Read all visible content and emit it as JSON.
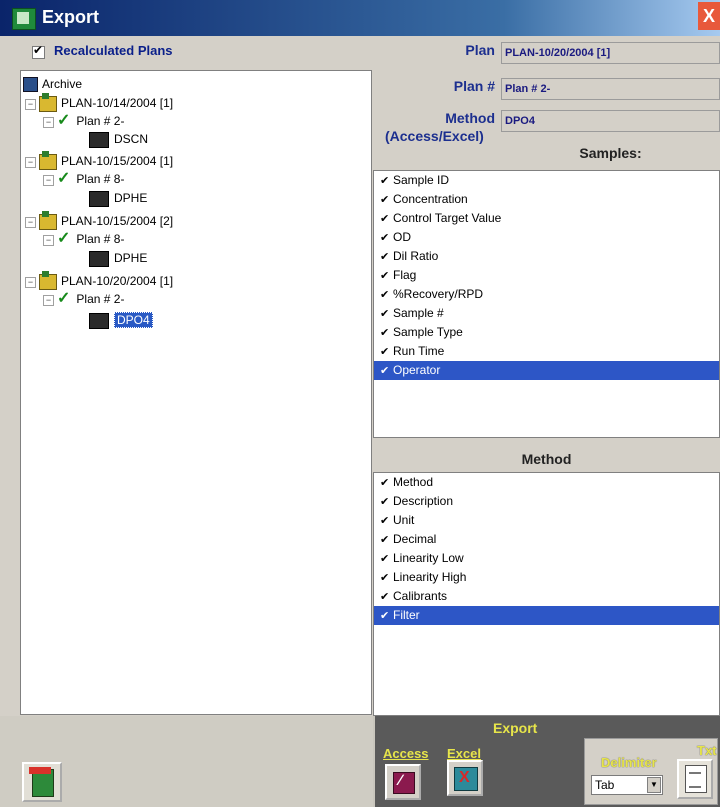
{
  "window": {
    "title": "Export",
    "close_glyph": "X"
  },
  "left": {
    "recalc_checkbox": {
      "label": "Recalculated Plans",
      "checked": true
    },
    "tree": {
      "root": "Archive",
      "plans": [
        {
          "label": "PLAN-10/14/2004 [1]",
          "plan_no": "Plan # 2-",
          "method": "DSCN",
          "selected": false
        },
        {
          "label": "PLAN-10/15/2004 [1]",
          "plan_no": "Plan # 8-",
          "method": "DPHE",
          "selected": false
        },
        {
          "label": "PLAN-10/15/2004 [2]",
          "plan_no": "Plan # 8-",
          "method": "DPHE",
          "selected": false
        },
        {
          "label": "PLAN-10/20/2004 [1]",
          "plan_no": "Plan # 2-",
          "method": "DPO4",
          "selected": true
        }
      ],
      "expander_glyph": "−",
      "check_glyph": "✓"
    }
  },
  "right": {
    "plan": {
      "label": "Plan",
      "value": "PLAN-10/20/2004 [1]"
    },
    "plan_no": {
      "label": "Plan #",
      "value": "Plan # 2-"
    },
    "method": {
      "label": "Method",
      "sublabel": "(Access/Excel)",
      "value": "DPO4"
    },
    "samples": {
      "header": "Samples:",
      "items": [
        {
          "label": "Sample ID",
          "checked": true
        },
        {
          "label": "Concentration",
          "checked": true
        },
        {
          "label": "Control Target Value",
          "checked": true
        },
        {
          "label": "OD",
          "checked": true
        },
        {
          "label": "Dil Ratio",
          "checked": true
        },
        {
          "label": "Flag",
          "checked": true
        },
        {
          "label": "%Recovery/RPD",
          "checked": true
        },
        {
          "label": "Sample #",
          "checked": true
        },
        {
          "label": "Sample Type",
          "checked": true
        },
        {
          "label": "Run Time",
          "checked": true
        },
        {
          "label": "Operator",
          "checked": true,
          "selected": true
        }
      ]
    },
    "method_fields": {
      "header": "Method",
      "items": [
        {
          "label": "Method",
          "checked": true
        },
        {
          "label": "Description",
          "checked": true
        },
        {
          "label": "Unit",
          "checked": true
        },
        {
          "label": "Decimal",
          "checked": true
        },
        {
          "label": "Linearity Low",
          "checked": true
        },
        {
          "label": "Linearity High",
          "checked": true
        },
        {
          "label": "Calibrants",
          "checked": true
        },
        {
          "label": "Filter",
          "checked": true,
          "selected": true
        }
      ]
    }
  },
  "bottom": {
    "export_title": "Export",
    "access_label": "Access",
    "excel_label": "Excel",
    "delimiter_label": "Delimiter",
    "txt_label": "Txt",
    "delimiter_value": "Tab",
    "colors": {
      "label_yellow": "#e7e54a",
      "selection_blue": "#2d56c6",
      "title_blue": "#0a246a"
    }
  }
}
